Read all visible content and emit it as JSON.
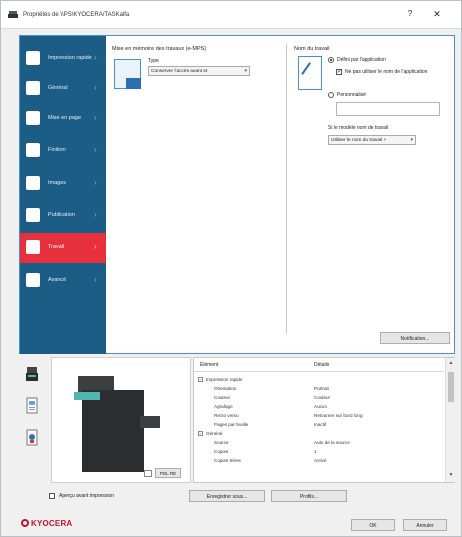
{
  "window": {
    "title": "Propriétés de \\\\PS\\KYOCERA/TASKalfa",
    "help_glyph": "?",
    "close_glyph": "✕"
  },
  "sidebar": {
    "items": [
      {
        "label": "Impression rapide",
        "icon": "quick-print-icon"
      },
      {
        "label": "Général",
        "icon": "general-icon"
      },
      {
        "label": "Mise en page",
        "icon": "layout-icon"
      },
      {
        "label": "Finition",
        "icon": "finishing-icon"
      },
      {
        "label": "Images",
        "icon": "imaging-icon"
      },
      {
        "label": "Publication",
        "icon": "publishing-icon"
      },
      {
        "label": "Travail",
        "icon": "job-icon",
        "active": true
      },
      {
        "label": "Avancé",
        "icon": "advanced-icon"
      }
    ],
    "colors": {
      "background": "#1c5d86",
      "active": "#e8303d"
    }
  },
  "job_storage": {
    "title": "Mise en mémoire des travaux (e-MPS)",
    "type_label": "Type",
    "type_value": "Conserver l'accès avant et"
  },
  "job_name": {
    "title": "Nom du travail",
    "option_app": "Défini par l'application",
    "option_no_user": "Ne pas utiliser le nom de l'application",
    "option_custom": "Personnalisé",
    "dup_label": "Si le modèle nom de travail",
    "dup_value": "Utiliser le nom du travail +"
  },
  "buttons": {
    "notification": "Notification...",
    "save_as": "Enregistrer sous...",
    "profiles": "Profils...",
    "ok": "OK",
    "cancel": "Annuler"
  },
  "preview": {
    "quick_print_label": "Aperçu avant impression",
    "paper_label": "PDL RE"
  },
  "properties": {
    "col_element": "Élément",
    "col_details": "Détails",
    "rows": [
      {
        "key": "Impression rapide",
        "value": "",
        "group": true
      },
      {
        "key": "Orientation",
        "value": "Portrait",
        "indent": 1
      },
      {
        "key": "Couleur",
        "value": "Couleur",
        "indent": 1
      },
      {
        "key": "Agrafage",
        "value": "Aucun",
        "indent": 1
      },
      {
        "key": "Recto verso",
        "value": "Retourner sur bord long",
        "indent": 1
      },
      {
        "key": "Pages par feuille",
        "value": "Inactif",
        "indent": 1
      },
      {
        "key": "Général",
        "value": "",
        "group": true
      },
      {
        "key": "Source",
        "value": "Auto de la source",
        "indent": 1
      },
      {
        "key": "Copies",
        "value": "1",
        "indent": 1
      },
      {
        "key": "Copies triées",
        "value": "Activé",
        "indent": 1
      }
    ]
  },
  "brand": {
    "logo_text": "KYOCERA",
    "color": "#c8102e"
  }
}
